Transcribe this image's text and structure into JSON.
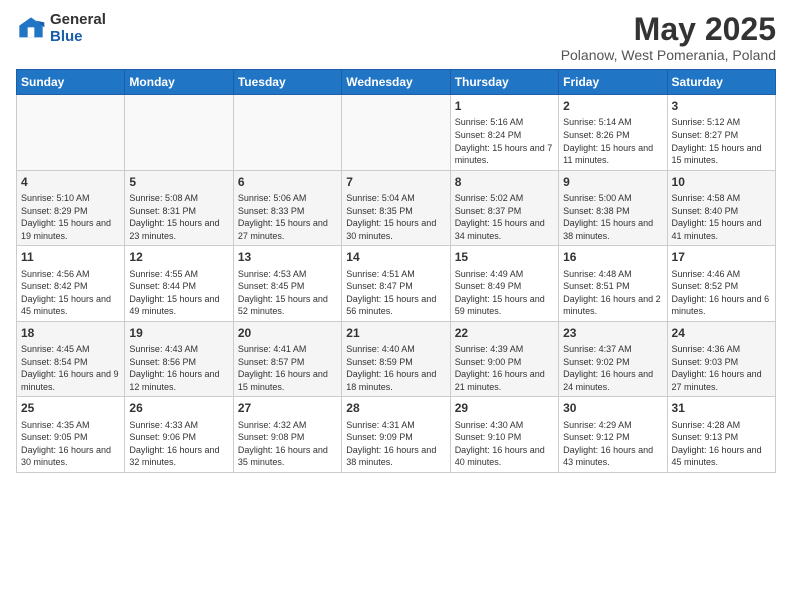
{
  "logo": {
    "general": "General",
    "blue": "Blue"
  },
  "title": "May 2025",
  "subtitle": "Polanow, West Pomerania, Poland",
  "days_of_week": [
    "Sunday",
    "Monday",
    "Tuesday",
    "Wednesday",
    "Thursday",
    "Friday",
    "Saturday"
  ],
  "weeks": [
    [
      {
        "num": "",
        "info": ""
      },
      {
        "num": "",
        "info": ""
      },
      {
        "num": "",
        "info": ""
      },
      {
        "num": "",
        "info": ""
      },
      {
        "num": "1",
        "info": "Sunrise: 5:16 AM\nSunset: 8:24 PM\nDaylight: 15 hours\nand 7 minutes."
      },
      {
        "num": "2",
        "info": "Sunrise: 5:14 AM\nSunset: 8:26 PM\nDaylight: 15 hours\nand 11 minutes."
      },
      {
        "num": "3",
        "info": "Sunrise: 5:12 AM\nSunset: 8:27 PM\nDaylight: 15 hours\nand 15 minutes."
      }
    ],
    [
      {
        "num": "4",
        "info": "Sunrise: 5:10 AM\nSunset: 8:29 PM\nDaylight: 15 hours\nand 19 minutes."
      },
      {
        "num": "5",
        "info": "Sunrise: 5:08 AM\nSunset: 8:31 PM\nDaylight: 15 hours\nand 23 minutes."
      },
      {
        "num": "6",
        "info": "Sunrise: 5:06 AM\nSunset: 8:33 PM\nDaylight: 15 hours\nand 27 minutes."
      },
      {
        "num": "7",
        "info": "Sunrise: 5:04 AM\nSunset: 8:35 PM\nDaylight: 15 hours\nand 30 minutes."
      },
      {
        "num": "8",
        "info": "Sunrise: 5:02 AM\nSunset: 8:37 PM\nDaylight: 15 hours\nand 34 minutes."
      },
      {
        "num": "9",
        "info": "Sunrise: 5:00 AM\nSunset: 8:38 PM\nDaylight: 15 hours\nand 38 minutes."
      },
      {
        "num": "10",
        "info": "Sunrise: 4:58 AM\nSunset: 8:40 PM\nDaylight: 15 hours\nand 41 minutes."
      }
    ],
    [
      {
        "num": "11",
        "info": "Sunrise: 4:56 AM\nSunset: 8:42 PM\nDaylight: 15 hours\nand 45 minutes."
      },
      {
        "num": "12",
        "info": "Sunrise: 4:55 AM\nSunset: 8:44 PM\nDaylight: 15 hours\nand 49 minutes."
      },
      {
        "num": "13",
        "info": "Sunrise: 4:53 AM\nSunset: 8:45 PM\nDaylight: 15 hours\nand 52 minutes."
      },
      {
        "num": "14",
        "info": "Sunrise: 4:51 AM\nSunset: 8:47 PM\nDaylight: 15 hours\nand 56 minutes."
      },
      {
        "num": "15",
        "info": "Sunrise: 4:49 AM\nSunset: 8:49 PM\nDaylight: 15 hours\nand 59 minutes."
      },
      {
        "num": "16",
        "info": "Sunrise: 4:48 AM\nSunset: 8:51 PM\nDaylight: 16 hours\nand 2 minutes."
      },
      {
        "num": "17",
        "info": "Sunrise: 4:46 AM\nSunset: 8:52 PM\nDaylight: 16 hours\nand 6 minutes."
      }
    ],
    [
      {
        "num": "18",
        "info": "Sunrise: 4:45 AM\nSunset: 8:54 PM\nDaylight: 16 hours\nand 9 minutes."
      },
      {
        "num": "19",
        "info": "Sunrise: 4:43 AM\nSunset: 8:56 PM\nDaylight: 16 hours\nand 12 minutes."
      },
      {
        "num": "20",
        "info": "Sunrise: 4:41 AM\nSunset: 8:57 PM\nDaylight: 16 hours\nand 15 minutes."
      },
      {
        "num": "21",
        "info": "Sunrise: 4:40 AM\nSunset: 8:59 PM\nDaylight: 16 hours\nand 18 minutes."
      },
      {
        "num": "22",
        "info": "Sunrise: 4:39 AM\nSunset: 9:00 PM\nDaylight: 16 hours\nand 21 minutes."
      },
      {
        "num": "23",
        "info": "Sunrise: 4:37 AM\nSunset: 9:02 PM\nDaylight: 16 hours\nand 24 minutes."
      },
      {
        "num": "24",
        "info": "Sunrise: 4:36 AM\nSunset: 9:03 PM\nDaylight: 16 hours\nand 27 minutes."
      }
    ],
    [
      {
        "num": "25",
        "info": "Sunrise: 4:35 AM\nSunset: 9:05 PM\nDaylight: 16 hours\nand 30 minutes."
      },
      {
        "num": "26",
        "info": "Sunrise: 4:33 AM\nSunset: 9:06 PM\nDaylight: 16 hours\nand 32 minutes."
      },
      {
        "num": "27",
        "info": "Sunrise: 4:32 AM\nSunset: 9:08 PM\nDaylight: 16 hours\nand 35 minutes."
      },
      {
        "num": "28",
        "info": "Sunrise: 4:31 AM\nSunset: 9:09 PM\nDaylight: 16 hours\nand 38 minutes."
      },
      {
        "num": "29",
        "info": "Sunrise: 4:30 AM\nSunset: 9:10 PM\nDaylight: 16 hours\nand 40 minutes."
      },
      {
        "num": "30",
        "info": "Sunrise: 4:29 AM\nSunset: 9:12 PM\nDaylight: 16 hours\nand 43 minutes."
      },
      {
        "num": "31",
        "info": "Sunrise: 4:28 AM\nSunset: 9:13 PM\nDaylight: 16 hours\nand 45 minutes."
      }
    ]
  ]
}
